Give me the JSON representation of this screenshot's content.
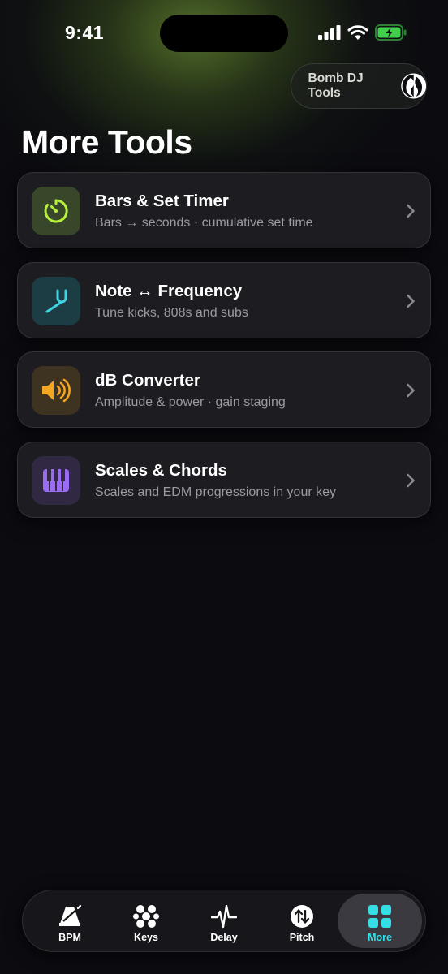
{
  "status_bar": {
    "time": "9:41",
    "icons": [
      "cellular-signal-icon",
      "wifi-icon",
      "battery-charging-icon"
    ]
  },
  "brand": {
    "label": "Bomb DJ Tools",
    "logo": "bomb-dj-logo"
  },
  "page": {
    "title": "More Tools"
  },
  "tools": [
    {
      "title": "Bars & Set Timer",
      "subtitle": "Bars → seconds · cumulative set time",
      "icon": "timer-icon",
      "accent": "#b7f03a",
      "icon_bg": "#38462a"
    },
    {
      "title": "Note ↔ Frequency",
      "subtitle": "Tune kicks, 808s and subs",
      "icon": "tuning-fork-icon",
      "accent": "#3fd4e0",
      "icon_bg": "#1d3d44"
    },
    {
      "title": "dB Converter",
      "subtitle": "Amplitude & power · gain staging",
      "icon": "speaker-icon",
      "accent": "#f5a623",
      "icon_bg": "#3e3320"
    },
    {
      "title": "Scales & Chords",
      "subtitle": "Scales and EDM progressions in your key",
      "icon": "piano-keys-icon",
      "accent": "#9b6cf2",
      "icon_bg": "#312944"
    }
  ],
  "tab_bar": {
    "active": "More",
    "active_color": "#33e0e6",
    "tabs": [
      {
        "label": "BPM",
        "icon": "metronome-icon"
      },
      {
        "label": "Keys",
        "icon": "keys-cluster-icon"
      },
      {
        "label": "Delay",
        "icon": "waveform-icon"
      },
      {
        "label": "Pitch",
        "icon": "pitch-arrows-icon"
      },
      {
        "label": "More",
        "icon": "grid-icon"
      }
    ]
  }
}
